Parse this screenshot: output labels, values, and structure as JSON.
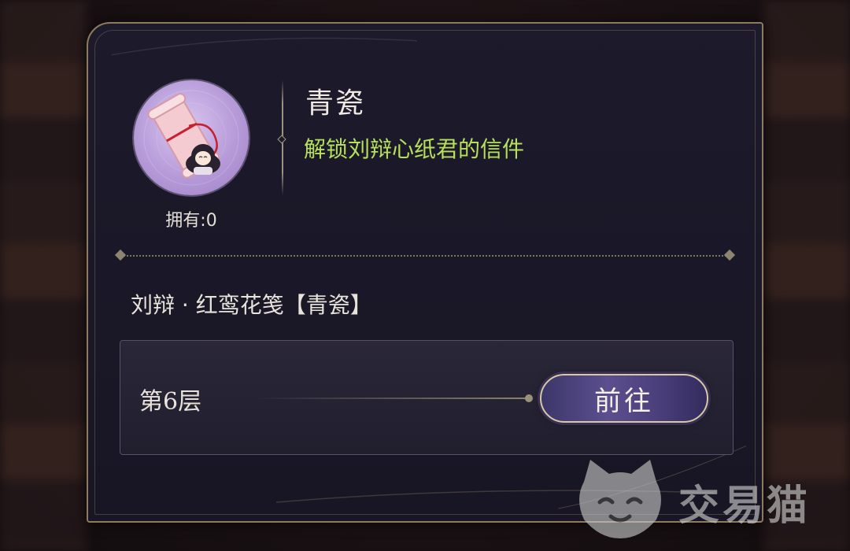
{
  "item": {
    "title": "青瓷",
    "description": "解锁刘辩心纸君的信件",
    "owned_text": "拥有:0"
  },
  "source": {
    "name": "刘辩 · 红鸾花笺【青瓷】",
    "route_label": "第6层",
    "goto_label": "前往"
  },
  "watermark": {
    "text": "交易猫"
  },
  "colors": {
    "description": "#b7e05a",
    "panel_border": "#8e7a5c",
    "button": "#4b3f7c"
  },
  "icons": {
    "avatar": "scroll-letter-chibi-icon",
    "watermark_logo": "cat-face-icon"
  }
}
